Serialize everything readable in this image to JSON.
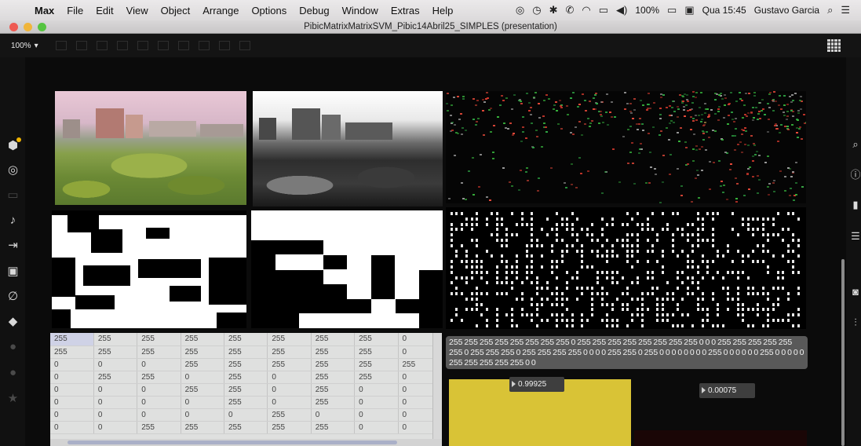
{
  "menubar": {
    "app_name": "Max",
    "items": [
      "File",
      "Edit",
      "View",
      "Object",
      "Arrange",
      "Options",
      "Debug",
      "Window",
      "Extras",
      "Help"
    ],
    "battery": "100%",
    "clock": "Qua 15:45",
    "user": "Gustavo Garcia"
  },
  "window": {
    "title": "PibicMatrixMatrixSVM_Pibic14Abril25_SIMPLES (presentation)"
  },
  "toolbar": {
    "zoom": "100%",
    "zoom_caret": "▾"
  },
  "cellblock": {
    "rows": [
      [
        "255",
        "255",
        "255",
        "255",
        "255",
        "255",
        "255",
        "255",
        "0"
      ],
      [
        "255",
        "255",
        "255",
        "255",
        "255",
        "255",
        "255",
        "255",
        "0"
      ],
      [
        "0",
        "0",
        "0",
        "255",
        "255",
        "255",
        "255",
        "255",
        "255"
      ],
      [
        "0",
        "255",
        "255",
        "0",
        "255",
        "0",
        "255",
        "255",
        "0"
      ],
      [
        "0",
        "0",
        "0",
        "255",
        "255",
        "0",
        "255",
        "0",
        "0"
      ],
      [
        "0",
        "0",
        "0",
        "0",
        "255",
        "0",
        "255",
        "0",
        "0"
      ],
      [
        "0",
        "0",
        "0",
        "0",
        "0",
        "255",
        "0",
        "0",
        "0"
      ],
      [
        "0",
        "0",
        "255",
        "255",
        "255",
        "255",
        "255",
        "0",
        "0"
      ]
    ]
  },
  "message": {
    "text": "255 255 255 255 255 255 255 255 0 255 255 255 255 255 255 255 255 0 0 0 255 255 255 255 255 255 0 255 255 255 0 255 255 255 255 0 0 0 0 255 255 0 255 0 0 0 0 0 0 0 0 255 0 0 0 0 0 0 255 0 0 0 0 0 255 255 255 255 255 0 0"
  },
  "numbers": {
    "value1": "0.99925",
    "value2": "0.00075"
  },
  "colors": {
    "multislider": "#d9c336",
    "accent_dot": "#f0b400"
  },
  "icons": {
    "left": [
      "package-icon",
      "target-icon",
      "clip-icon",
      "music-note-icon",
      "io-icon",
      "image-icon",
      "link-icon",
      "plug-icon",
      "circle-icon",
      "help-icon",
      "star-icon"
    ],
    "right": [
      "search-icon",
      "info-icon",
      "panel-icon",
      "list-icon",
      "camera-icon",
      "sliders-icon"
    ]
  }
}
